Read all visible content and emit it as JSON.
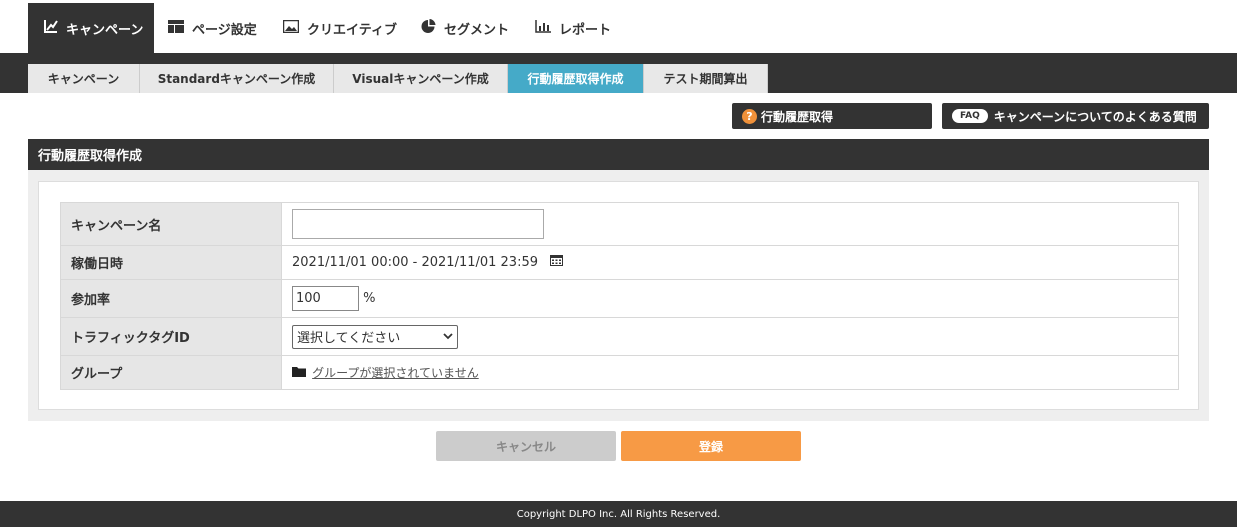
{
  "topnav": {
    "items": [
      {
        "label": "キャンペーン",
        "icon": "chart-icon"
      },
      {
        "label": "ページ設定",
        "icon": "layout-icon"
      },
      {
        "label": "クリエイティブ",
        "icon": "image-icon"
      },
      {
        "label": "セグメント",
        "icon": "pie-icon"
      },
      {
        "label": "レポート",
        "icon": "bar-chart-icon"
      }
    ]
  },
  "subnav": {
    "tabs": [
      {
        "label": "キャンペーン"
      },
      {
        "label": "Standardキャンペーン作成"
      },
      {
        "label": "Visualキャンペーン作成"
      },
      {
        "label": "行動履歴取得作成"
      },
      {
        "label": "テスト期間算出"
      }
    ]
  },
  "help": {
    "history_label": "行動履歴取得",
    "faq_badge": "FAQ",
    "faq_label": "キャンペーンについてのよくある質問"
  },
  "panel": {
    "title": "行動履歴取得作成"
  },
  "form": {
    "name_label": "キャンペーン名",
    "name_value": "",
    "period_label": "稼働日時",
    "period_value": "2021/11/01 00:00 - 2021/11/01 23:59",
    "rate_label": "参加率",
    "rate_value": "100",
    "rate_unit": "%",
    "tag_label": "トラフィックタグID",
    "tag_selected": "選択してください",
    "group_label": "グループ",
    "group_value": "グループが選択されていません"
  },
  "buttons": {
    "cancel": "キャンセル",
    "save": "登録"
  },
  "footer": {
    "copyright": "Copyright DLPO Inc. All Rights Reserved."
  },
  "colors": {
    "dark": "#333333",
    "active_tab": "#45aac8",
    "accent_orange": "#f79a45"
  }
}
